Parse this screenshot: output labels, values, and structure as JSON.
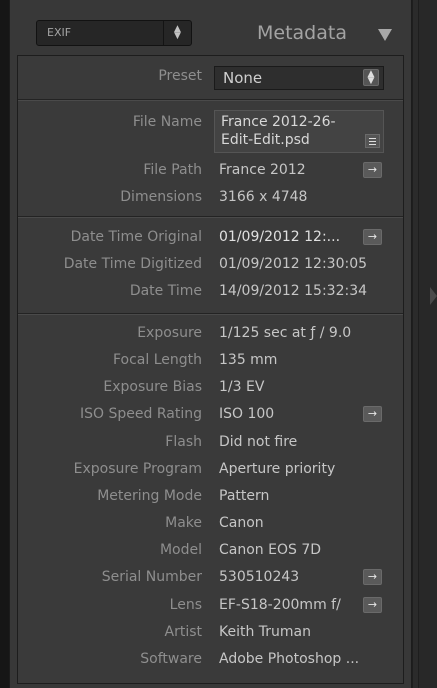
{
  "header": {
    "dropdown_value": "EXIF",
    "title": "Metadata"
  },
  "preset": {
    "label": "Preset",
    "value": "None"
  },
  "file": {
    "name_label": "File Name",
    "name_line1": "France 2012-26-",
    "name_line2": "Edit-Edit.psd",
    "path_label": "File Path",
    "path_value": "France 2012",
    "dimensions_label": "Dimensions",
    "dimensions_value": "3166 x 4748"
  },
  "dates": [
    {
      "label": "Date Time Original",
      "value": "01/09/2012 12:...",
      "bright": true,
      "arrow": true
    },
    {
      "label": "Date Time Digitized",
      "value": "01/09/2012 12:30:05",
      "bright": false,
      "arrow": false
    },
    {
      "label": "Date Time",
      "value": "14/09/2012 15:32:34",
      "bright": false,
      "arrow": false
    }
  ],
  "exif": [
    {
      "label": "Exposure",
      "value": "1/125 sec at ƒ / 9.0",
      "arrow": false
    },
    {
      "label": "Focal Length",
      "value": "135 mm",
      "arrow": false
    },
    {
      "label": "Exposure Bias",
      "value": "1/3 EV",
      "arrow": false
    },
    {
      "label": "ISO Speed Rating",
      "value": "ISO 100",
      "arrow": true
    },
    {
      "label": "Flash",
      "value": "Did not fire",
      "arrow": false
    },
    {
      "label": "Exposure Program",
      "value": "Aperture priority",
      "arrow": false
    },
    {
      "label": "Metering Mode",
      "value": "Pattern",
      "arrow": false
    },
    {
      "label": "Make",
      "value": "Canon",
      "arrow": false
    },
    {
      "label": "Model",
      "value": "Canon EOS 7D",
      "arrow": false
    },
    {
      "label": "Serial Number",
      "value": "530510243",
      "arrow": true
    },
    {
      "label": "Lens",
      "value": "EF-S18-200mm f/",
      "arrow": true
    },
    {
      "label": "Artist",
      "value": "Keith Truman",
      "arrow": false
    },
    {
      "label": "Software",
      "value": "Adobe Photoshop ...",
      "arrow": false
    }
  ],
  "icons": {
    "spinner": "up-down-arrows-icon",
    "arrow": "go-to-arrow-icon",
    "list": "list-icon",
    "collapse": "triangle-down-icon"
  }
}
